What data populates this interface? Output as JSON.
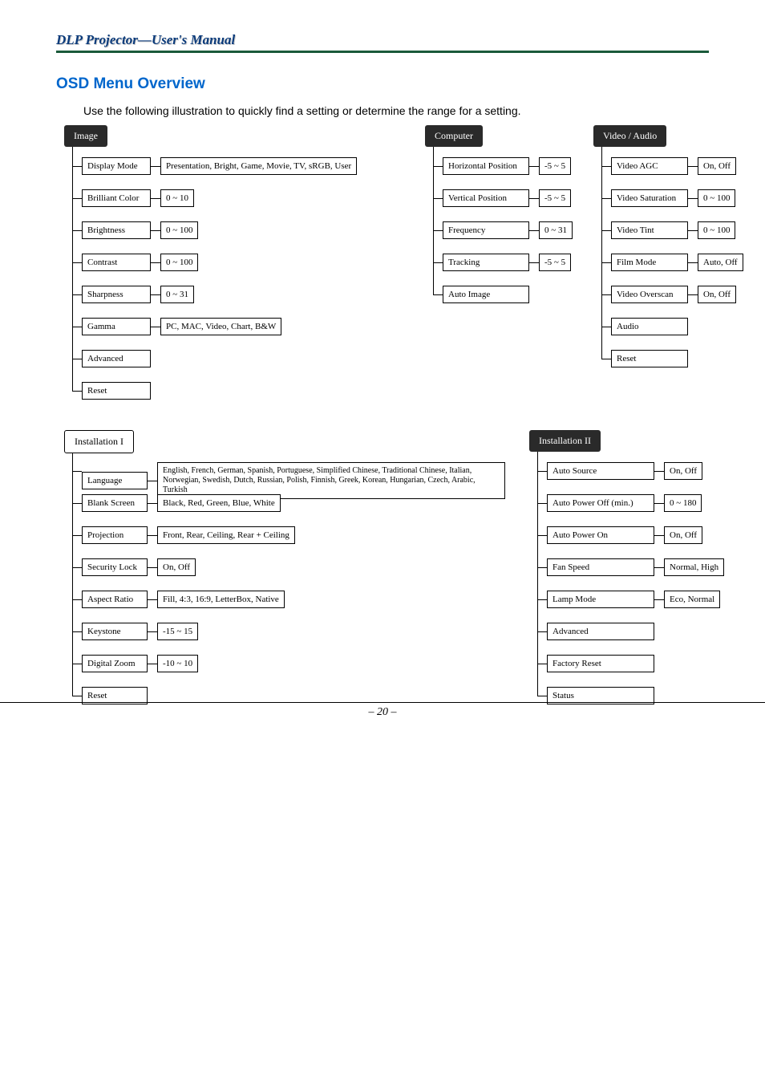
{
  "page_header": "DLP Projector—User's Manual",
  "section_title": "OSD Menu Overview",
  "intro_text": "Use the following illustration to quickly find a setting or determine the range for a setting.",
  "page_number": "– 20 –",
  "menus": {
    "image": {
      "title": "Image",
      "rows": [
        {
          "label": "Display Mode",
          "value": "Presentation, Bright, Game, Movie, TV, sRGB, User"
        },
        {
          "label": "Brilliant Color",
          "value": "0 ~ 10"
        },
        {
          "label": "Brightness",
          "value": "0 ~ 100"
        },
        {
          "label": "Contrast",
          "value": "0 ~ 100"
        },
        {
          "label": "Sharpness",
          "value": "0 ~ 31"
        },
        {
          "label": "Gamma",
          "value": "PC, MAC, Video, Chart, B&W"
        },
        {
          "label": "Advanced",
          "value": null
        },
        {
          "label": "Reset",
          "value": null
        }
      ]
    },
    "computer": {
      "title": "Computer",
      "rows": [
        {
          "label": "Horizontal Position",
          "value": "-5 ~ 5"
        },
        {
          "label": "Vertical Position",
          "value": "-5 ~ 5"
        },
        {
          "label": "Frequency",
          "value": "0 ~ 31"
        },
        {
          "label": "Tracking",
          "value": "-5 ~ 5"
        },
        {
          "label": "Auto Image",
          "value": null
        }
      ]
    },
    "video_audio": {
      "title": "Video / Audio",
      "rows": [
        {
          "label": "Video AGC",
          "value": "On, Off"
        },
        {
          "label": "Video Saturation",
          "value": "0 ~ 100"
        },
        {
          "label": "Video Tint",
          "value": "0 ~ 100"
        },
        {
          "label": "Film Mode",
          "value": "Auto, Off"
        },
        {
          "label": "Video Overscan",
          "value": "On, Off"
        },
        {
          "label": "Audio",
          "value": null
        },
        {
          "label": "Reset",
          "value": null
        }
      ]
    },
    "install1": {
      "title": "Installation I",
      "rows": [
        {
          "label": "Language",
          "value": "English, French, German, Spanish, Portuguese, Simplified Chinese, Traditional Chinese, Italian, Norwegian, Swedish, Dutch, Russian, Polish, Finnish, Greek, Korean, Hungarian, Czech, Arabic, Turkish"
        },
        {
          "label": "Blank Screen",
          "value": "Black, Red, Green, Blue, White"
        },
        {
          "label": "Projection",
          "value": "Front, Rear, Ceiling, Rear + Ceiling"
        },
        {
          "label": "Security Lock",
          "value": "On, Off"
        },
        {
          "label": "Aspect Ratio",
          "value": "Fill, 4:3, 16:9, LetterBox, Native"
        },
        {
          "label": "Keystone",
          "value": "-15 ~ 15"
        },
        {
          "label": "Digital Zoom",
          "value": "-10 ~ 10"
        },
        {
          "label": "Reset",
          "value": null
        }
      ]
    },
    "install2": {
      "title": "Installation II",
      "rows": [
        {
          "label": "Auto Source",
          "value": "On, Off"
        },
        {
          "label": "Auto Power Off (min.)",
          "value": "0 ~ 180"
        },
        {
          "label": "Auto Power On",
          "value": "On, Off"
        },
        {
          "label": "Fan Speed",
          "value": "Normal, High"
        },
        {
          "label": "Lamp Mode",
          "value": "Eco, Normal"
        },
        {
          "label": "Advanced",
          "value": null
        },
        {
          "label": "Factory Reset",
          "value": null
        },
        {
          "label": "Status",
          "value": null
        }
      ]
    }
  }
}
